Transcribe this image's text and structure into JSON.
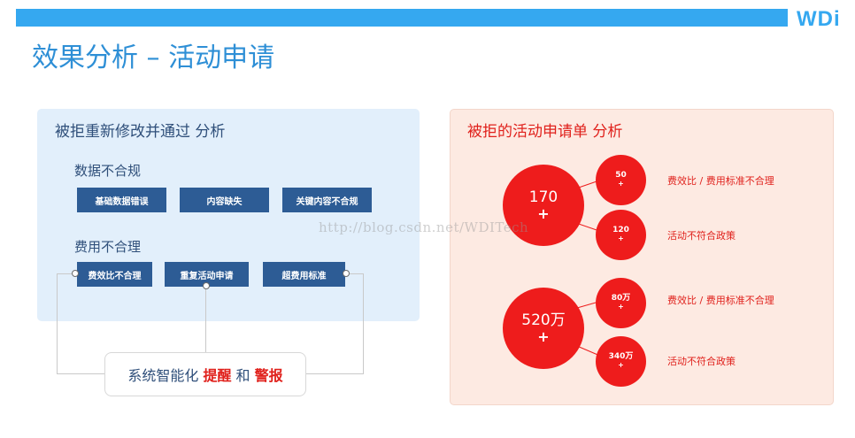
{
  "header": {
    "logo_text": "WDi",
    "title": "效果分析 – 活动申请"
  },
  "left_panel": {
    "heading": "被拒重新修改并通过 分析",
    "group1": {
      "title": "数据不合规",
      "tags": [
        "基础数据错误",
        "内容缺失",
        "关键内容不合规"
      ]
    },
    "group2": {
      "title": "费用不合理",
      "tags": [
        "费效比不合理",
        "重复活动申请",
        "超费用标准"
      ]
    },
    "callout": {
      "prefix": "系统智能化 ",
      "highlight1": "提醒",
      "middle": " 和 ",
      "highlight2": "警报"
    }
  },
  "right_panel": {
    "heading": "被拒的活动申请单 分析",
    "cluster1": {
      "main": {
        "value": "170",
        "plus": "+"
      },
      "items": [
        {
          "value": "50",
          "plus": "+",
          "label": "费效比 / 费用标准不合理"
        },
        {
          "value": "120",
          "plus": "+",
          "label": "活动不符合政策"
        }
      ]
    },
    "cluster2": {
      "main": {
        "value": "520万",
        "plus": "+"
      },
      "items": [
        {
          "value": "80万",
          "plus": "+",
          "label": "费效比 / 费用标准不合理"
        },
        {
          "value": "340万",
          "plus": "+",
          "label": "活动不符合政策"
        }
      ]
    }
  },
  "watermark": "http://blog.csdn.net/WDITech",
  "colors": {
    "accent_blue": "#35a8f0",
    "title_blue": "#2e8fd6",
    "tag_navy": "#2d5c95",
    "alert_red": "#ee1c1c"
  }
}
